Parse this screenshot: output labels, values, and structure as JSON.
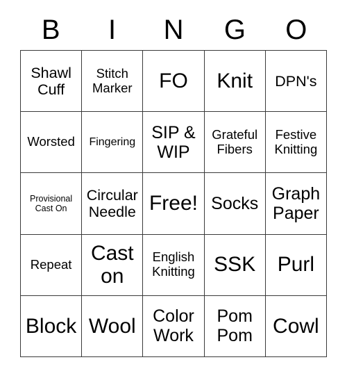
{
  "card": {
    "columns": [
      "B",
      "I",
      "N",
      "G",
      "O"
    ],
    "rows": [
      [
        {
          "text": "Shawl\nCuff",
          "size": "lg"
        },
        {
          "text": "Stitch\nMarker",
          "size": "md"
        },
        {
          "text": "FO",
          "size": "xxl"
        },
        {
          "text": "Knit",
          "size": "xxl"
        },
        {
          "text": "DPN's",
          "size": "lg"
        }
      ],
      [
        {
          "text": "Worsted",
          "size": "md"
        },
        {
          "text": "Fingering",
          "size": "sm"
        },
        {
          "text": "SIP &\nWIP",
          "size": "xl"
        },
        {
          "text": "Grateful\nFibers",
          "size": "md"
        },
        {
          "text": "Festive\nKnitting",
          "size": "md"
        }
      ],
      [
        {
          "text": "Provisional\nCast On",
          "size": "xs"
        },
        {
          "text": "Circular\nNeedle",
          "size": "lg"
        },
        {
          "text": "Free!",
          "size": "xxl"
        },
        {
          "text": "Socks",
          "size": "xl"
        },
        {
          "text": "Graph\nPaper",
          "size": "xl"
        }
      ],
      [
        {
          "text": "Repeat",
          "size": "md"
        },
        {
          "text": "Cast\non",
          "size": "xxl"
        },
        {
          "text": "English\nKnitting",
          "size": "md"
        },
        {
          "text": "SSK",
          "size": "xxl"
        },
        {
          "text": "Purl",
          "size": "xxl"
        }
      ],
      [
        {
          "text": "Block",
          "size": "xxl"
        },
        {
          "text": "Wool",
          "size": "xxl"
        },
        {
          "text": "Color\nWork",
          "size": "xl"
        },
        {
          "text": "Pom\nPom",
          "size": "xl"
        },
        {
          "text": "Cowl",
          "size": "xxl"
        }
      ]
    ]
  },
  "colors": {
    "background": "#ffffff",
    "border": "#3a3a3a",
    "text": "#000000"
  }
}
